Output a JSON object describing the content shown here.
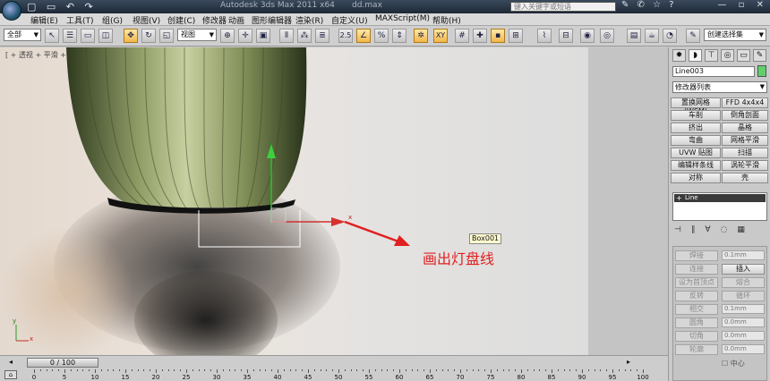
{
  "titlebar": {
    "quick_access": "▢ ▭ ↶ ↷",
    "app_title": "Autodesk 3ds Max  2011 x64",
    "document": "dd.max",
    "search_placeholder": "键入关键字或短语",
    "icons": "✎ ✆ ☆ ?",
    "window_controls": "— ▫ ✕"
  },
  "menu": {
    "items": [
      "编辑(E)",
      "工具(T)",
      "组(G)",
      "视图(V)",
      "创建(C)",
      "修改器",
      "动画",
      "图形编辑器",
      "渲染(R)",
      "自定义(U)",
      "MAXScript(M)",
      "帮助(H)"
    ]
  },
  "toolbar": {
    "selection_filter": "全部",
    "reference_coord": "视图",
    "named_selection": "创建选择集",
    "snap_2_5": "2.5",
    "snap_xy": "XY"
  },
  "viewport": {
    "label": "[ + 透视 + 平滑 + 高光 ]",
    "object_tooltip": "Box001",
    "annotation": "画出灯盘线",
    "axis_y": "y",
    "axis_x": "x",
    "gizmo_x": "x"
  },
  "command_panel": {
    "object_name": "Line003",
    "object_color": "#5fd16a",
    "modifier_list": "修改器列表",
    "modifier_buttons": [
      "置换网格 (WSM)",
      "FFD 4x4x4",
      "车削",
      "倒角剖面",
      "挤出",
      "晶格",
      "弯曲",
      "网格平滑",
      "UVW 贴图",
      "扫描",
      "编辑样条线",
      "涡轮平滑",
      "对称",
      "壳"
    ],
    "stack_item": "Line",
    "geometry_buttons": [
      "焊接",
      "连接",
      "设为首顶点",
      "反转",
      "相交",
      "圆角",
      "切角",
      "轮廓"
    ],
    "geometry_right_buttons": [
      "插入",
      "熔合",
      "循环"
    ],
    "spinner_values": [
      "0.1mm",
      "0.1mm",
      "0.0mm",
      "0.0mm",
      "0.0mm"
    ],
    "center_label": "中心"
  },
  "timeline": {
    "slider": "0 / 100",
    "ticks": [
      "0",
      "5",
      "10",
      "15",
      "20",
      "25",
      "30",
      "35",
      "40",
      "45",
      "50",
      "55",
      "60",
      "65",
      "70",
      "75",
      "80",
      "85",
      "90",
      "95",
      "100"
    ]
  }
}
